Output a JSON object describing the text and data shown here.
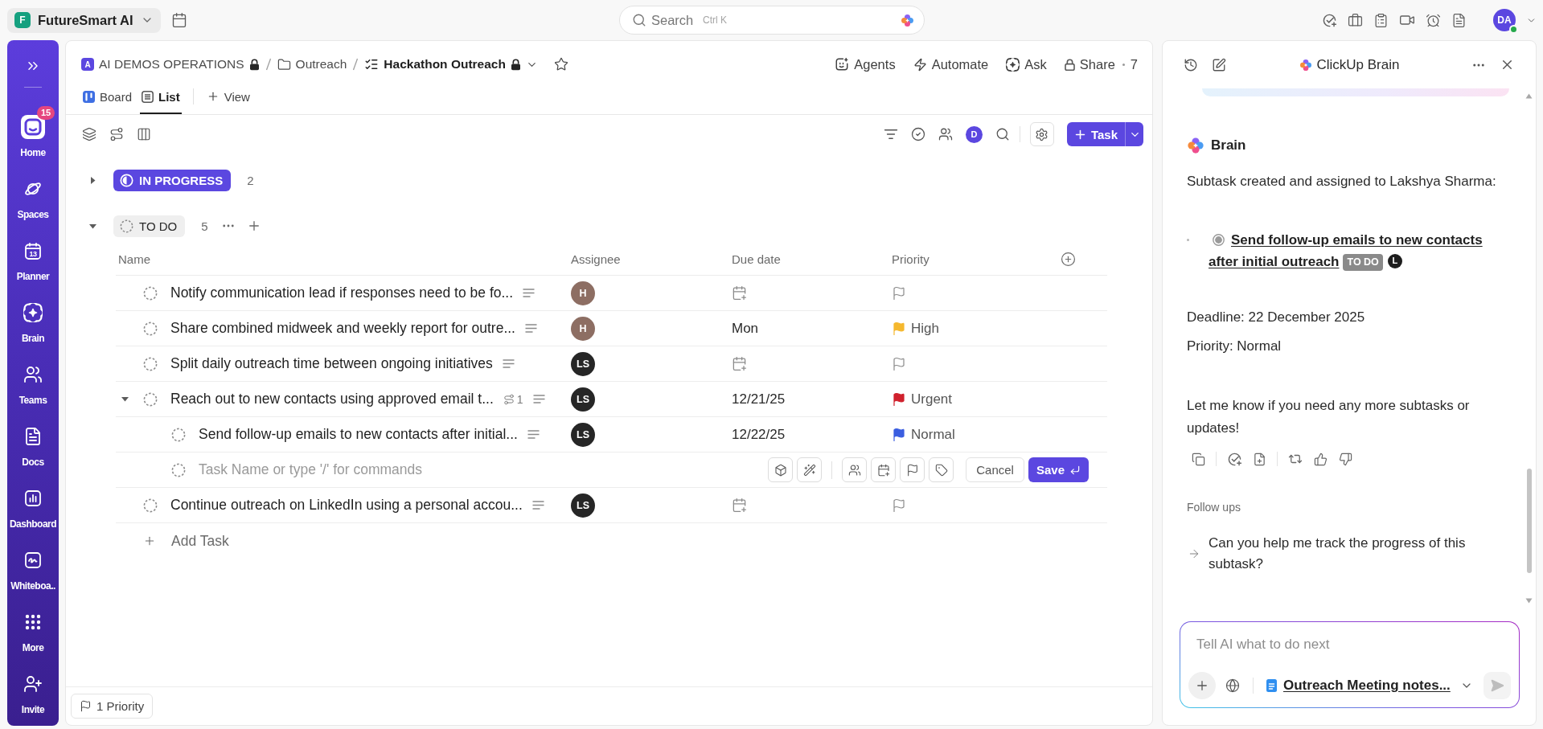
{
  "top_bar": {
    "workspace": {
      "initial": "F",
      "name": "FutureSmart AI"
    },
    "search": {
      "placeholder": "Search",
      "shortcut": "Ctrl K"
    },
    "user": {
      "initials": "DA",
      "online": true
    }
  },
  "sidebar": {
    "items": [
      {
        "label": "Home",
        "badge": "15",
        "selected": true
      },
      {
        "label": "Spaces",
        "selected": false
      },
      {
        "label": "Planner",
        "date": "13",
        "selected": false
      },
      {
        "label": "Brain",
        "selected": false
      },
      {
        "label": "Teams",
        "selected": false
      },
      {
        "label": "Docs",
        "selected": false
      },
      {
        "label": "Dashboard",
        "selected": false
      },
      {
        "label": "Whiteboa..",
        "selected": false
      },
      {
        "label": "More",
        "selected": false
      },
      {
        "label": "Invite",
        "selected": false
      }
    ]
  },
  "breadcrumb": [
    {
      "kind": "space",
      "initial": "A",
      "label": "AI DEMOS OPERATIONS",
      "locked": true,
      "current": false
    },
    {
      "kind": "folder",
      "label": "Outreach",
      "locked": false,
      "current": false
    },
    {
      "kind": "list",
      "label": "Hackathon Outreach",
      "locked": true,
      "current": true
    }
  ],
  "header_actions": [
    {
      "kind": "agents",
      "label": "Agents"
    },
    {
      "kind": "automate",
      "label": "Automate"
    },
    {
      "kind": "ask",
      "label": "Ask"
    },
    {
      "kind": "share",
      "label": "Share",
      "count": "7"
    }
  ],
  "views": {
    "tabs": [
      {
        "kind": "board",
        "label": "Board",
        "selected": false
      },
      {
        "kind": "list",
        "label": "List",
        "selected": true
      }
    ],
    "add_label": "View"
  },
  "toolbar": {
    "assignee_filter": "D",
    "add_task": "Task"
  },
  "groups": [
    {
      "kind": "in_progress",
      "status": "IN PROGRESS",
      "count": "2",
      "expanded": false
    },
    {
      "kind": "todo",
      "status": "TO DO",
      "count": "5",
      "expanded": true,
      "columns": [
        "Name",
        "Assignee",
        "Due date",
        "Priority"
      ],
      "tasks": [
        {
          "name": "Notify communication lead if responses need to be fo...",
          "has_description": true,
          "assignee": {
            "initials": "H",
            "color": "#8d6e63"
          }
        },
        {
          "name": "Share combined midweek and weekly report for outre...",
          "has_description": true,
          "assignee": {
            "initials": "H",
            "color": "#8d6e63"
          },
          "due": "Mon",
          "priority": {
            "label": "High",
            "color": "#f5b82e"
          }
        },
        {
          "name": "Split daily outreach time between ongoing initiatives",
          "has_description": true,
          "assignee": {
            "initials": "LS",
            "color": "#262626"
          }
        },
        {
          "name": "Reach out to new contacts using approved email t...",
          "has_description": true,
          "assignee": {
            "initials": "LS",
            "color": "#262626"
          },
          "due": "12/21/25",
          "priority": {
            "label": "Urgent",
            "color": "#d0212d"
          },
          "subtask_count": "1",
          "expanded": true,
          "children": [
            {
              "name": "Send follow-up emails to new contacts after initial...",
              "has_description": true,
              "assignee": {
                "initials": "LS",
                "color": "#262626"
              },
              "due": "12/22/25",
              "priority": {
                "label": "Normal",
                "color": "#3b5ee0"
              }
            }
          ],
          "new_subtask": {
            "placeholder": "Task Name or type '/' for commands",
            "cancel": "Cancel",
            "save": "Save"
          }
        },
        {
          "name": "Continue outreach on LinkedIn using a personal accou...",
          "has_description": true,
          "assignee": {
            "initials": "LS",
            "color": "#262626"
          }
        }
      ],
      "add_task": "Add Task"
    }
  ],
  "footer": {
    "filter": "1 Priority"
  },
  "brain_panel": {
    "title": "ClickUp Brain",
    "message": {
      "author": "Brain",
      "intro": "Subtask created and assigned to Lakshya Sharma:",
      "task": {
        "name": "Send follow-up emails to new contacts after initial outreach",
        "status": "TO DO",
        "assignee_initial": "L"
      },
      "details": [
        "Deadline: 22 December 2025",
        "Priority: Normal"
      ],
      "closing": "Let me know if you need any more subtasks or updates!"
    },
    "follow_ups_title": "Follow ups",
    "follow_ups": [
      "Can you help me track the progress of this subtask?"
    ],
    "composer": {
      "placeholder": "Tell AI what to do next",
      "attachment": "Outreach Meeting notes..."
    }
  }
}
